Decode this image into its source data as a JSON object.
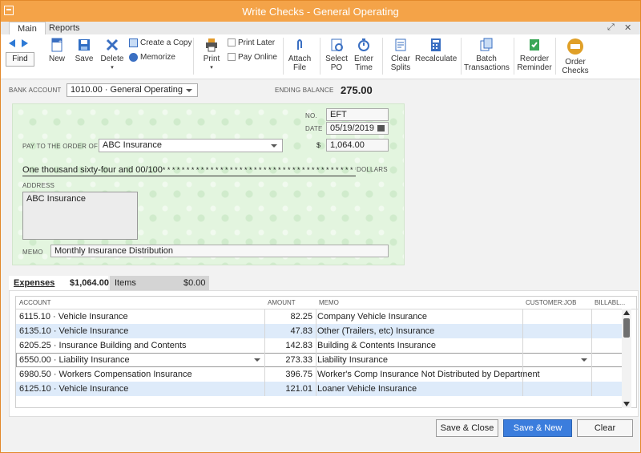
{
  "window": {
    "title": "Write Checks - General Operating"
  },
  "tabs": {
    "main": "Main",
    "reports": "Reports"
  },
  "window_controls": {
    "expand": "⤢",
    "close": "✕"
  },
  "toolbar": {
    "find": "Find",
    "new": "New",
    "save": "Save",
    "delete": "Delete",
    "create_copy": "Create a Copy",
    "memorize": "Memorize",
    "print": "Print",
    "print_later": "Print Later",
    "pay_online": "Pay Online",
    "attach_file_1": "Attach",
    "attach_file_2": "File",
    "select_po_1": "Select",
    "select_po_2": "PO",
    "enter_time_1": "Enter",
    "enter_time_2": "Time",
    "clear_splits_1": "Clear",
    "clear_splits_2": "Splits",
    "recalculate": "Recalculate",
    "batch_1": "Batch",
    "batch_2": "Transactions",
    "reorder_1": "Reorder",
    "reorder_2": "Reminder",
    "order_checks_1": "Order",
    "order_checks_2": "Checks"
  },
  "bank": {
    "label": "BANK ACCOUNT",
    "account": "1010.00 · General Operating",
    "ending_label": "ENDING BALANCE",
    "ending_balance": "275.00"
  },
  "check": {
    "no_label": "NO.",
    "no": "EFT",
    "date_label": "DATE",
    "date": "05/19/2019",
    "pay_label": "PAY TO THE ORDER OF",
    "payee": "ABC Insurance",
    "dollar_sign": "$",
    "amount": "1,064.00",
    "amount_words": "One thousand sixty-four and 00/100",
    "stars": "*  *  *  *  *  *  *  *  *  *  *  *  *  *  *  *  *  *  *  *  *  *  *  *  *  *  *  *  *  *  *  *  *  *  *  *  *  *  *  *  *  *  *  *  *",
    "dollars_label": "DOLLARS",
    "address_label": "ADDRESS",
    "address": "ABC Insurance",
    "memo_label": "MEMO",
    "memo": "Monthly Insurance Distribution"
  },
  "lower_tabs": {
    "expenses_label": "Expenses",
    "expenses_total": "$1,064.00",
    "items_label": "Items",
    "items_total": "$0.00"
  },
  "table": {
    "headers": {
      "account": "ACCOUNT",
      "amount": "AMOUNT",
      "memo": "MEMO",
      "customer": "CUSTOMER:JOB",
      "billable": "BILLABL..."
    },
    "rows": [
      {
        "account": "6115.10 · Vehicle Insurance",
        "amount": "82.25",
        "memo": "Company Vehicle Insurance"
      },
      {
        "account": "6135.10 · Vehicle Insurance",
        "amount": "47.83",
        "memo": "Other (Trailers, etc) Insurance"
      },
      {
        "account": "6205.25 · Insurance Building and Contents",
        "amount": "142.83",
        "memo": "Building & Contents Insurance"
      },
      {
        "account": "6550.00 · Liability Insurance",
        "amount": "273.33",
        "memo": "Liability Insurance"
      },
      {
        "account": "6980.50 · Workers Compensation Insurance",
        "amount": "396.75",
        "memo": "Worker's Comp Insurance Not Distributed by Department"
      },
      {
        "account": "6125.10 · Vehicle Insurance",
        "amount": "121.01",
        "memo": "Loaner Vehicle Insurance"
      }
    ]
  },
  "buttons": {
    "save_close": "Save & Close",
    "save_new": "Save & New",
    "clear": "Clear"
  },
  "colors": {
    "title_bar": "#f4a348",
    "check_bg": "#e3f5df",
    "row_alt": "#deebfa",
    "primary": "#3b7ddd"
  }
}
